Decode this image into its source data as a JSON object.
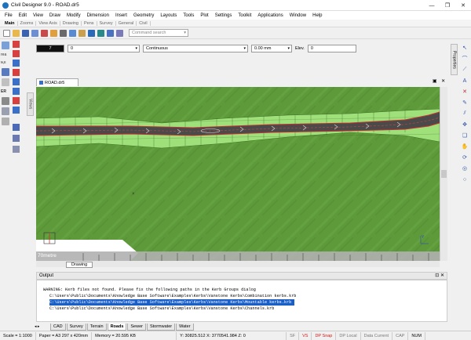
{
  "window": {
    "title": "Civil Designer 9.0 - ROAD.dr5"
  },
  "menu": [
    "File",
    "Edit",
    "View",
    "Draw",
    "Modify",
    "Dimension",
    "Insert",
    "Geometry",
    "Layouts",
    "Tools",
    "Plot",
    "Settings",
    "Toolkit",
    "Applications",
    "Window",
    "Help"
  ],
  "ribbon_tabs": [
    "Main",
    "Zooms",
    "View Axis",
    "Drawing",
    "Pens",
    "Survey",
    "General",
    "Civil"
  ],
  "toolbar": {
    "command_search_placeholder": "Command search"
  },
  "properties": {
    "color": "7",
    "layer": "0",
    "linetype": "Continuous",
    "lineweight": "0.00 mm",
    "elev_label": "Elev.",
    "elev_value": "0"
  },
  "left_labels": {
    "area": "rea",
    "ne": "ɴ,ᴇ",
    "er": "ER"
  },
  "views_tab": "Views",
  "properties_tab": "Properties",
  "document_tab": "ROAD.dr5",
  "drawing": {
    "scale_label": "70metre",
    "layout_tab": "Drawing",
    "axis_y": "Y"
  },
  "output": {
    "title": "Output",
    "pin": "⊡ ✕",
    "lines": [
      "WARNING: Kerb files not found. Please fix the following paths in the Kerb Groups dialog",
      "C:\\Users\\Public\\Documents\\Knowledge Base Software\\Examples\\Kerbs\\Vanstone Kerbs\\Combination kerbs.krb",
      "C:\\Users\\Public\\Documents\\Knowledge Base Software\\Examples\\Kerbs\\Vanstone Kerbs\\Mountable kerbs.krb",
      "C:\\Users\\Public\\Documents\\Knowledge Base Software\\Examples\\Kerbs\\Vanstone Kerbs\\Channels.krb"
    ]
  },
  "bottom_tabs": [
    "CAD",
    "Survey",
    "Terrain",
    "Roads",
    "Sewer",
    "Stormwater",
    "Water"
  ],
  "bottom_active": "Roads",
  "status": {
    "scale": "Scale = 1:1000",
    "paper": "Paper = A3 297 x 420mm",
    "memory": "Memory = 20.595 KB",
    "coords": "Y: 30825.512 X: 3770541.984 Z: 0",
    "sf": "SF",
    "vs": "VS",
    "dp_snap": "DP Snap",
    "dp_local": "DP Local",
    "data_current": "Data Current",
    "caps": "CAP",
    "num": "NUM"
  },
  "colors": {
    "terrain": "#5e9a3a",
    "road": "#4a4a4a",
    "edge": "#c83232",
    "selection": "#1a5fc8"
  }
}
